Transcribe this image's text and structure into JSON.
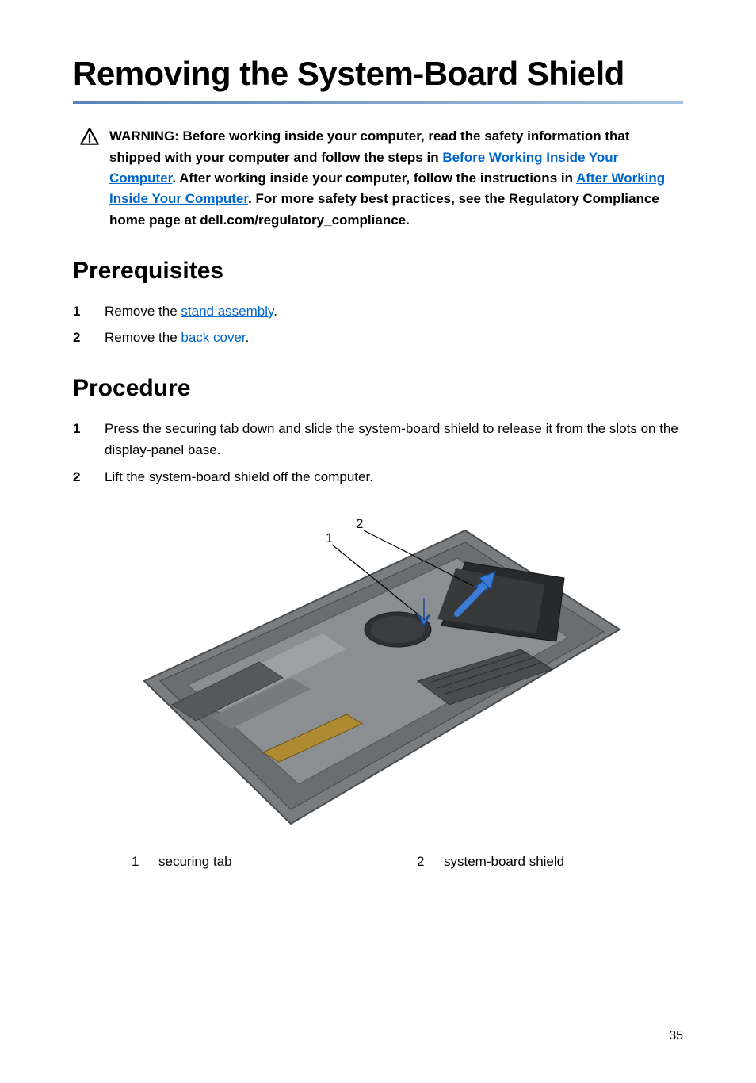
{
  "title": "Removing the System-Board Shield",
  "warning": {
    "prefix": "WARNING: Before working inside your computer, read the safety information that shipped with your computer and follow the steps in ",
    "link1_text": "Before Working Inside Your Computer",
    "middle1": ". After working inside your computer, follow the instructions in ",
    "link2_text": "After Working Inside Your Computer",
    "suffix": ". For more safety best practices, see the Regulatory Compliance home page at dell.com/regulatory_compliance."
  },
  "sections": {
    "prerequisites": {
      "heading": "Prerequisites",
      "items": [
        {
          "num": "1",
          "prefix": "Remove the ",
          "link": "stand assembly",
          "suffix": "."
        },
        {
          "num": "2",
          "prefix": "Remove the ",
          "link": "back cover",
          "suffix": "."
        }
      ]
    },
    "procedure": {
      "heading": "Procedure",
      "items": [
        {
          "num": "1",
          "text": "Press the securing tab down and slide the system-board shield to release it from the slots on the display-panel base."
        },
        {
          "num": "2",
          "text": "Lift the system-board shield off the computer."
        }
      ]
    }
  },
  "diagram": {
    "callouts": {
      "c1": "1",
      "c2": "2"
    }
  },
  "legend": {
    "items": [
      {
        "num": "1",
        "label": "securing tab"
      },
      {
        "num": "2",
        "label": "system-board shield"
      }
    ]
  },
  "page_number": "35"
}
